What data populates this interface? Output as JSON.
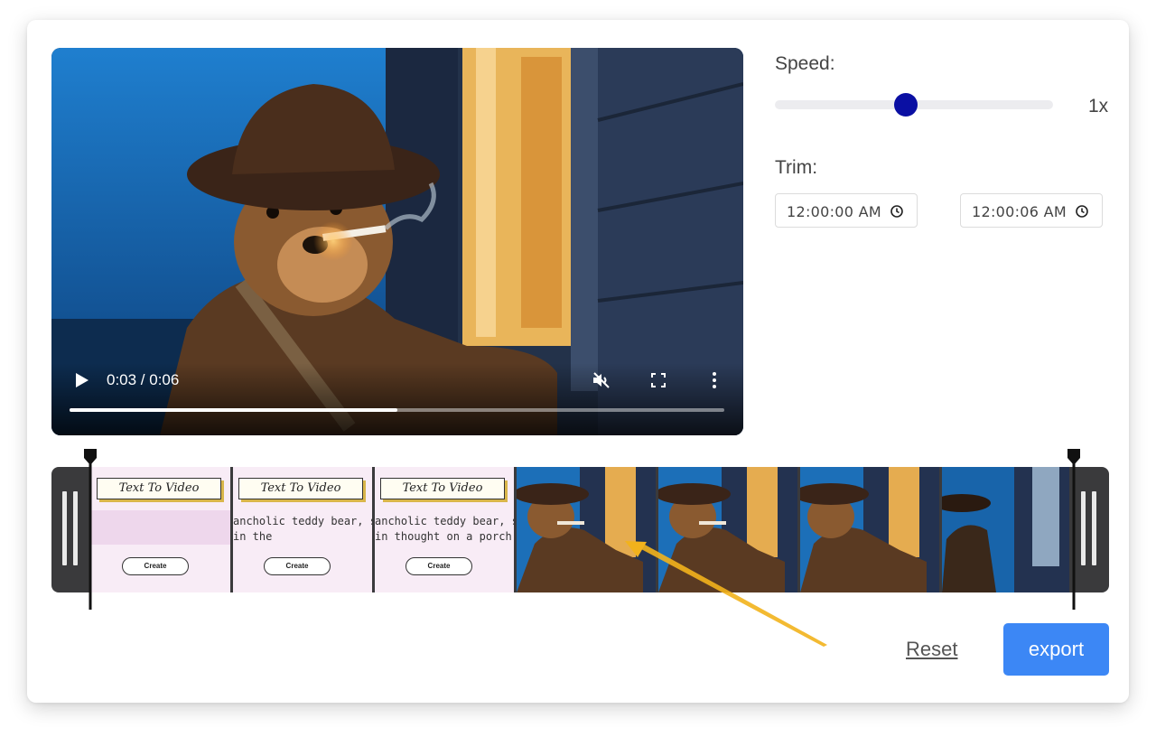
{
  "player": {
    "current_time": "0:03",
    "duration": "0:06",
    "time_display": "0:03 / 0:06",
    "progress": 0.5,
    "muted": true
  },
  "speed": {
    "label": "Speed:",
    "value_text": "1x",
    "slider_fraction": 0.47,
    "thumb_color": "#0a0fa3"
  },
  "trim": {
    "label": "Trim:",
    "start": "12:00:00 AM",
    "end": "12:00:06 AM"
  },
  "timeline": {
    "frames": [
      {
        "kind": "text",
        "banner": "Text To Video",
        "caption1": "",
        "caption2": "",
        "button": "Create"
      },
      {
        "kind": "text",
        "banner": "Text To Video",
        "caption1": "ancholic teddy bear, smok",
        "caption2": " in the",
        "button": "Create"
      },
      {
        "kind": "text",
        "banner": "Text To Video",
        "caption1": "ancholic teddy bear, smok",
        "caption2": " in thought on a porch.",
        "button": "Create"
      },
      {
        "kind": "scene"
      },
      {
        "kind": "scene"
      },
      {
        "kind": "scene"
      },
      {
        "kind": "scene"
      }
    ]
  },
  "actions": {
    "reset_label": "Reset",
    "export_label": "export"
  },
  "colors": {
    "export_button": "#3c87f5",
    "annotation_arrow": "#f2b21c",
    "timeline_bg": "#3a3a3c"
  }
}
